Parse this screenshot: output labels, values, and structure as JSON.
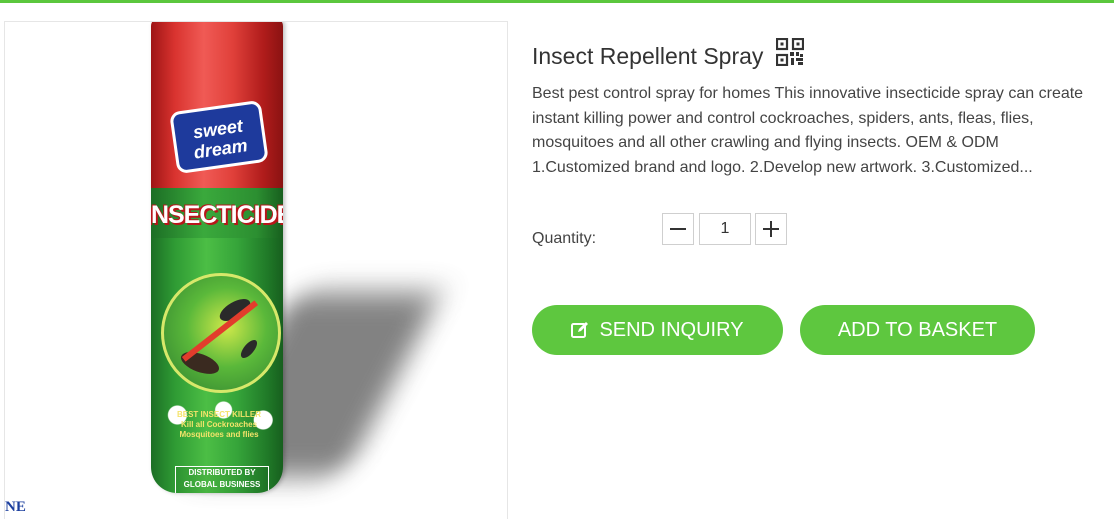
{
  "product": {
    "title": "Insect Repellent Spray",
    "description": "Best pest control spray for homes This innovative insecticide spray can create instant killing power and control cockroaches, spiders, ants, fleas, flies, mosquitoes and all other crawling and flying insects. OEM & ODM 1.Customized brand and logo. 2.Develop new artwork. 3.Customized...",
    "qr_icon": "qr-code-icon"
  },
  "image": {
    "brand_logo_text": "sweet dream",
    "product_word": "INSECTICIDE",
    "label_lines": "BEST INSECT KILLER\nKill all Cockroaches\nMosquitoes and flies",
    "distributor_text": "DISTRIBUTED BY\nGLOBAL BUSINESS",
    "corner_text": "NE"
  },
  "quantity": {
    "label": "Quantity:",
    "value": "1",
    "minus_icon": "minus-icon",
    "plus_icon": "plus-icon"
  },
  "actions": {
    "inquiry_label": "SEND INQUIRY",
    "inquiry_icon": "edit-icon",
    "basket_label": "ADD TO BASKET"
  },
  "colors": {
    "accent": "#5ec73f",
    "top_bar": "#5bc73d"
  }
}
